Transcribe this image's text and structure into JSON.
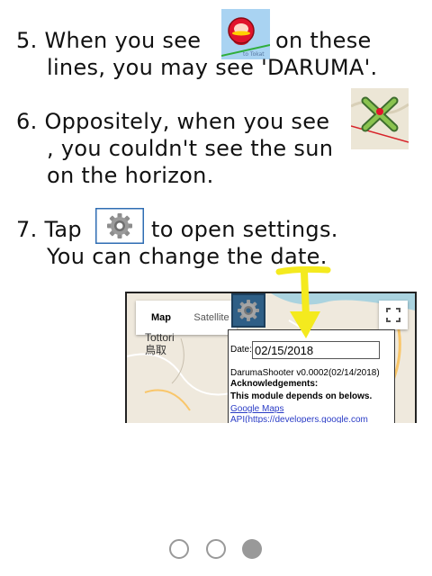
{
  "steps": [
    {
      "number": "5.",
      "line1_a": "When you see",
      "line1_b": "on these",
      "line2": "lines, you may see 'DARUMA'."
    },
    {
      "number": "6.",
      "line1": "Oppositely, when you see",
      "line2": ", you couldn't see the sun",
      "line3": "on the horizon."
    },
    {
      "number": "7.",
      "line1_a": "Tap",
      "line1_b": "to open settings.",
      "line2": "You can change the date."
    }
  ],
  "icons": {
    "step5": "map-pin-icon",
    "step6": "x-marker-icon",
    "step7": "gear-icon",
    "annotation": "yellow-arrow-icon"
  },
  "screenshot": {
    "map_tab": "Map",
    "satellite_tab": "Satellite",
    "city_en": "Tottori",
    "city_ja": "鳥取",
    "dialog": {
      "date_label": "Date:",
      "date_value": "02/15/2018",
      "version": "DarumaShooter v0.0002(02/14/2018)",
      "ack": "Acknowledgements:",
      "depends": "This module depends on belows.",
      "link1": "Google Maps",
      "link2": "API(https://developers.google.com"
    }
  },
  "pager": {
    "total": 3,
    "active_index": 2
  },
  "colors": {
    "accent": "#2f6db3",
    "arrow": "#f4ea1e",
    "dot": "#999999"
  }
}
